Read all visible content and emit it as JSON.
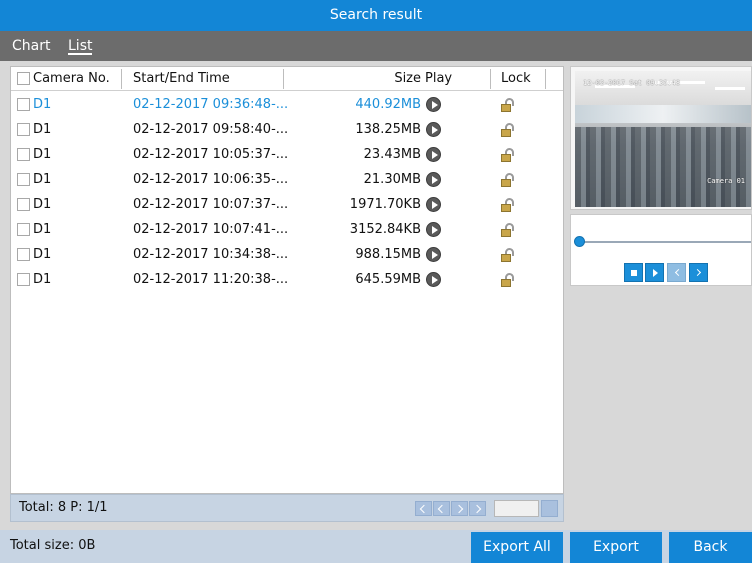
{
  "window": {
    "title": "Search result"
  },
  "tabs": [
    {
      "label": "Chart",
      "active": false
    },
    {
      "label": "List",
      "active": true
    }
  ],
  "table": {
    "headers": {
      "camera": "Camera No.",
      "time": "Start/End Time",
      "size": "Size",
      "play": "Play",
      "lock": "Lock"
    },
    "rows": [
      {
        "camera": "D1",
        "time": "02-12-2017 09:36:48-...",
        "size": "440.92MB",
        "selected": true
      },
      {
        "camera": "D1",
        "time": "02-12-2017 09:58:40-...",
        "size": "138.25MB",
        "selected": false
      },
      {
        "camera": "D1",
        "time": "02-12-2017 10:05:37-...",
        "size": "23.43MB",
        "selected": false
      },
      {
        "camera": "D1",
        "time": "02-12-2017 10:06:35-...",
        "size": "21.30MB",
        "selected": false
      },
      {
        "camera": "D1",
        "time": "02-12-2017 10:07:37-...",
        "size": "1971.70KB",
        "selected": false
      },
      {
        "camera": "D1",
        "time": "02-12-2017 10:07:41-...",
        "size": "3152.84KB",
        "selected": false
      },
      {
        "camera": "D1",
        "time": "02-12-2017 10:34:38-...",
        "size": "988.15MB",
        "selected": false
      },
      {
        "camera": "D1",
        "time": "02-12-2017 11:20:38-...",
        "size": "645.59MB",
        "selected": false
      }
    ]
  },
  "pager": {
    "summary": "Total: 8  P: 1/1"
  },
  "preview": {
    "osd_date": "12-02-2017 Sat 09:36:48",
    "osd_camera": "Camera 01"
  },
  "footer": {
    "total_size": "Total size: 0B"
  },
  "buttons": {
    "export_all": "Export All",
    "export": "Export",
    "back": "Back"
  },
  "colors": {
    "accent": "#1386d6",
    "selected_text": "#1b8fd9",
    "tab_bar": "#6c6c6c",
    "footer_bar": "#c7d4e3"
  },
  "icons": [
    "play-icon",
    "lock-icon",
    "stop-icon",
    "chevron-left-icon",
    "chevron-right-icon",
    "first-page-icon",
    "prev-page-icon",
    "next-page-icon",
    "last-page-icon"
  ]
}
